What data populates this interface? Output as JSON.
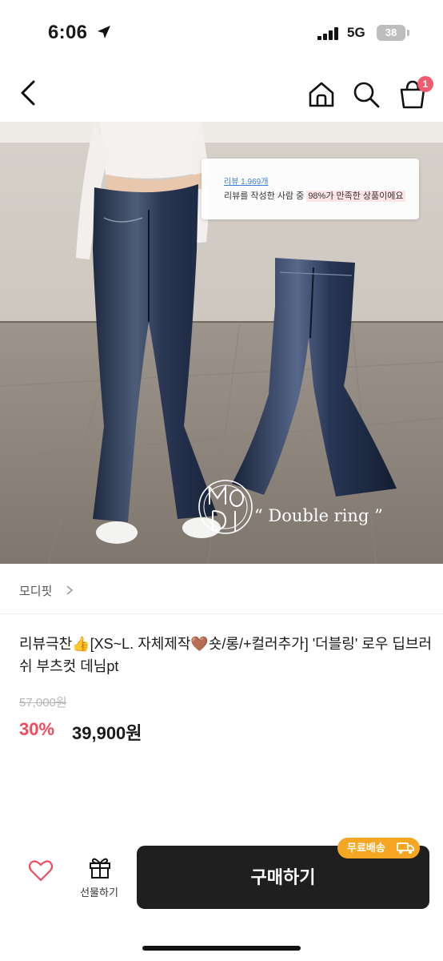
{
  "status_bar": {
    "time": "6:06",
    "network": "5G",
    "battery": "38"
  },
  "top_nav": {
    "icons": [
      "back-icon",
      "home-icon",
      "search-icon",
      "cart-icon"
    ],
    "cart_count": "1"
  },
  "hero": {
    "review_count": "리뷰 1,969개",
    "review_text_prefix": "리뷰를 작성한 사람 중 ",
    "review_text_highlight": "98%가 만족한 상품이에요",
    "brand_tagline": "“ Double ring ”",
    "brand_logo_text": "MODI"
  },
  "store": {
    "name": "모디핏",
    "chevron": "chevron-right-icon"
  },
  "product": {
    "title": "리뷰극찬👍[XS~L. 자체제작🤎숏/롱/+컬러추가] '더블링' 로우 딥브러쉬 부츠컷 데님pt",
    "original_price": "57,000원",
    "discount": "30%",
    "sale_price": "39,900원"
  },
  "bottom_bar": {
    "like_icon": "heart-icon",
    "gift_label": "선물하기",
    "buy_label": "구매하기",
    "shipping_badge": "무료배송"
  },
  "colors": {
    "accent": "#ef4a5e",
    "badge": "#f5a623",
    "buy_button": "#1f1f1f",
    "link": "#3c7ed8"
  }
}
